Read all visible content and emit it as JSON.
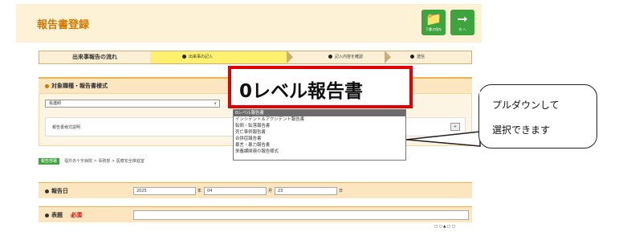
{
  "header": {
    "title": "報告書登録",
    "draft_button_label": "下書き保存",
    "next_button_label": "次 へ",
    "draft_icon": "folder-icon",
    "next_icon": "arrow-right-icon"
  },
  "steps": {
    "flow_label": "出来事報告の流れ",
    "items": [
      "出来事の記入",
      "記入内容を確認",
      "送信"
    ]
  },
  "section_type": {
    "heading": "対象職種・報告書様式",
    "job_select_value": "看護師",
    "format_description_label": "報告書様式説明"
  },
  "dropdown": {
    "options": [
      "0レベル報告書",
      "インシデント＆アクシデント報告書",
      "転倒・転落報告書",
      "死亡事例報告書",
      "合併症報告書",
      "暴言・暴力報告書",
      "栄養課関連の報告様式"
    ],
    "selected_index": 0
  },
  "callout": {
    "selected_text": "0レベル報告書",
    "balloon_line1": "プルダウンして",
    "balloon_line2": "選択できます"
  },
  "breadcrumb": {
    "badge": "報告部署",
    "path": "福井赤十字病院 > 事務部 > 医療安全推進室"
  },
  "date_row": {
    "label": "報告日",
    "year": "2025",
    "year_unit": "年",
    "month": "04",
    "month_unit": "月",
    "day": "23",
    "day_unit": "日"
  },
  "title_row": {
    "label": "表題",
    "required": "必須"
  },
  "colors": {
    "accent_orange": "#d27900",
    "green_button": "#3ea53e",
    "red_callout": "#e00000",
    "current_step": "#fff16f"
  }
}
